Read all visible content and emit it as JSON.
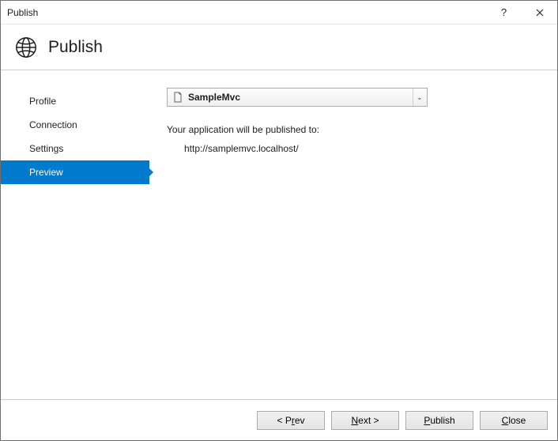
{
  "window": {
    "title": "Publish"
  },
  "header": {
    "title": "Publish"
  },
  "sidebar": {
    "items": [
      {
        "label": "Profile"
      },
      {
        "label": "Connection"
      },
      {
        "label": "Settings"
      },
      {
        "label": "Preview"
      }
    ],
    "activeIndex": 3
  },
  "profileDropdown": {
    "selected": "SampleMvc"
  },
  "message": "Your application will be published to:",
  "publishUrl": "http://samplemvc.localhost/",
  "buttons": {
    "prev": "< Prev",
    "next": "Next >",
    "publish": "Publish",
    "close": "Close"
  }
}
